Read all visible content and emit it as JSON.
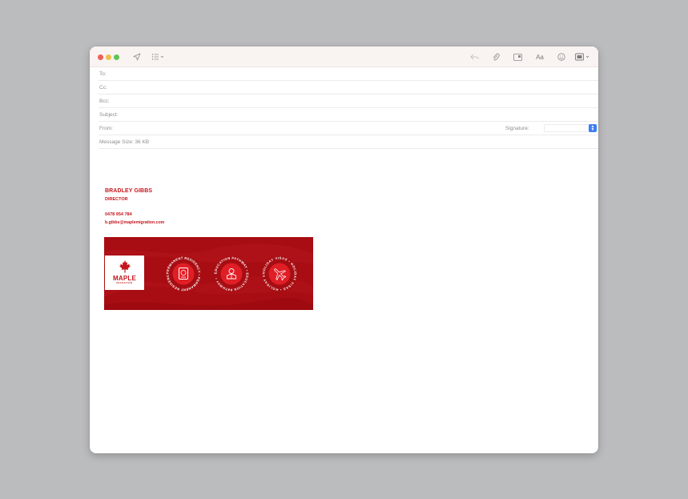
{
  "compose": {
    "to_label": "To:",
    "cc_label": "Cc:",
    "bcc_label": "Bcc:",
    "subject_label": "Subject:",
    "from_label": "From:",
    "signature_label": "Signature:",
    "message_size": "Message Size: 36 KB"
  },
  "toolbar": {
    "font_button_label": "Aa"
  },
  "signature": {
    "name": "BRADLEY GIBBS",
    "title": "DIRECTOR",
    "phone": "0478 954 784",
    "email": "b.gibbs@maplemigration.com",
    "logo_name": "MAPLE",
    "logo_sub": "MIGRATION",
    "badges": [
      {
        "text": "PERMANENT RESIDENCY • PERMANENT RESIDENCY •",
        "icon": "passport-icon"
      },
      {
        "text": "EDUCATION PATHWAY • EDUCATION PATHWAY •",
        "icon": "graduate-icon"
      },
      {
        "text": "HOLIDAY VISAS • HOLIDAY VISAS • HOLIDAY VISAS •",
        "icon": "airplane-icon"
      }
    ]
  },
  "colors": {
    "brand_red": "#c4161c",
    "banner_red": "#a70d12",
    "badge_red": "#e01e26",
    "accent_blue": "#3d7ef2"
  }
}
